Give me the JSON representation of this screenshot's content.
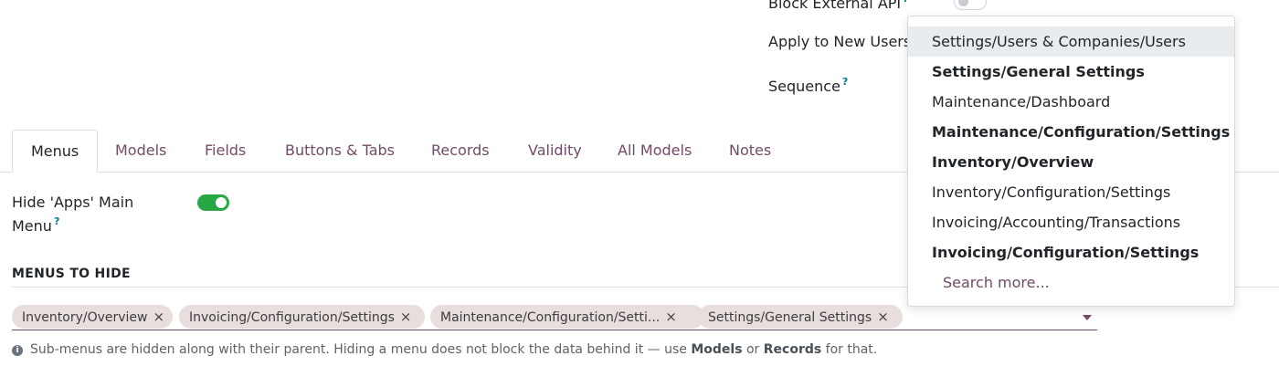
{
  "top_fields": {
    "block_external_api": {
      "label": "Block External API",
      "help": "?"
    },
    "apply_new_users": {
      "label": "Apply to New Users"
    },
    "sequence": {
      "label": "Sequence",
      "help": "?"
    }
  },
  "tabs": [
    {
      "label": "Menus",
      "active": true
    },
    {
      "label": "Models"
    },
    {
      "label": "Fields"
    },
    {
      "label": "Buttons & Tabs"
    },
    {
      "label": "Records"
    },
    {
      "label": "Validity"
    },
    {
      "label": "All Models"
    },
    {
      "label": "Notes"
    }
  ],
  "hide_apps": {
    "label_line1": "Hide 'Apps' Main",
    "label_line2": "Menu",
    "help": "?",
    "value": true
  },
  "menus_section": {
    "title": "MENUS TO HIDE",
    "tags": [
      "Inventory/Overview",
      "Invoicing/Configuration/Settings",
      "Maintenance/Configuration/Setti...",
      "Settings/General Settings"
    ],
    "remove_glyph": "×"
  },
  "hint": {
    "part1": "Sub-menus are hidden along with their parent. Hiding a menu does not block the data behind it — use ",
    "models": "Models",
    "or": " or ",
    "records": "Records",
    "part2": " for that."
  },
  "dropdown": {
    "items": [
      {
        "label": "Settings/Users & Companies/Users",
        "highlighted": true,
        "bold": false
      },
      {
        "label": "Settings/General Settings",
        "bold": true
      },
      {
        "label": "Maintenance/Dashboard",
        "bold": false
      },
      {
        "label": "Maintenance/Configuration/Settings",
        "bold": true
      },
      {
        "label": "Inventory/Overview",
        "bold": true
      },
      {
        "label": "Inventory/Configuration/Settings",
        "bold": false
      },
      {
        "label": "Invoicing/Accounting/Transactions",
        "bold": false
      },
      {
        "label": "Invoicing/Configuration/Settings",
        "bold": true
      }
    ],
    "search_more": "Search more..."
  },
  "colors": {
    "brand": "#714b67",
    "toggle_on": "#28a745",
    "help": "#017e84"
  }
}
